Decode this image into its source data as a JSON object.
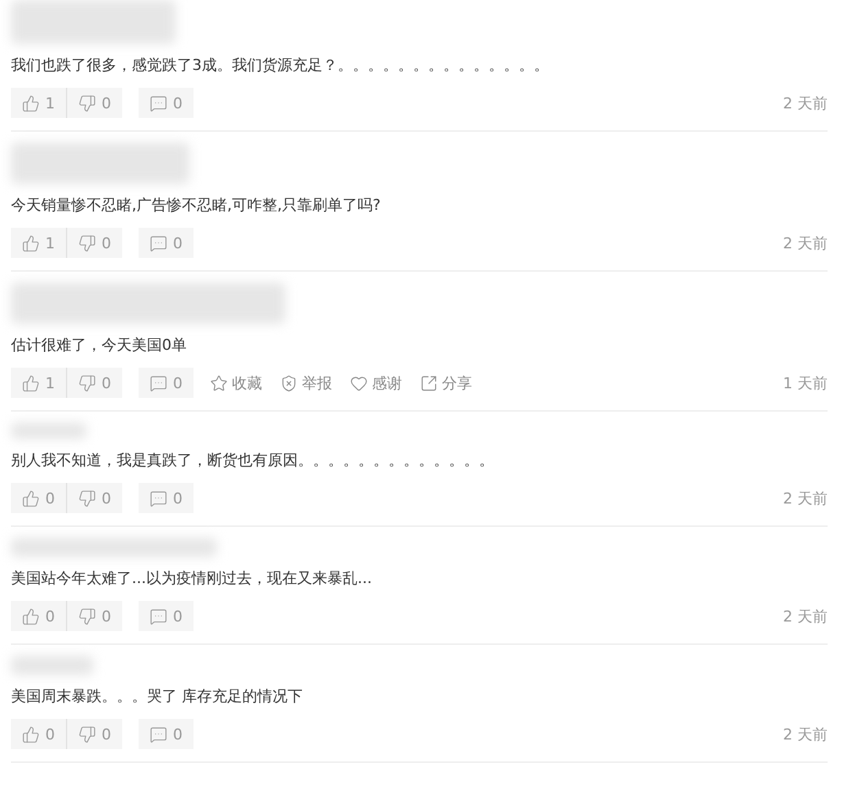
{
  "comments": [
    {
      "text": "我们也跌了很多，感觉跌了3成。我们货源充足？。。。。。。。。。。。。。。",
      "likes": "1",
      "dislikes": "0",
      "replies": "0",
      "time": "2 天前"
    },
    {
      "text": "今天销量惨不忍睹,广告惨不忍睹,可咋整,只靠刷单了吗?",
      "likes": "1",
      "dislikes": "0",
      "replies": "0",
      "time": "2 天前"
    },
    {
      "text": "估计很难了，今天美国0单",
      "likes": "1",
      "dislikes": "0",
      "replies": "0",
      "time": "1 天前",
      "extra_actions": [
        {
          "kind": "star",
          "label": "收藏"
        },
        {
          "kind": "report",
          "label": "举报"
        },
        {
          "kind": "thanks",
          "label": "感谢"
        },
        {
          "kind": "share",
          "label": "分享"
        }
      ]
    },
    {
      "text": "别人我不知道，我是真跌了，断货也有原因。。。。。。。。。。。。。",
      "likes": "0",
      "dislikes": "0",
      "replies": "0",
      "time": "2 天前"
    },
    {
      "text": "美国站今年太难了...以为疫情刚过去，现在又来暴乱...",
      "likes": "0",
      "dislikes": "0",
      "replies": "0",
      "time": "2 天前"
    },
    {
      "text": "美国周末暴跌。。。哭了  库存充足的情况下",
      "likes": "0",
      "dislikes": "0",
      "replies": "0",
      "time": "2 天前"
    }
  ]
}
